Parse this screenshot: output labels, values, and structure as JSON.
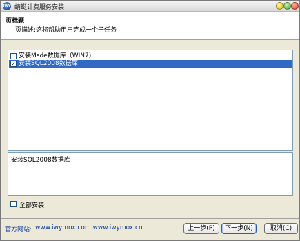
{
  "window": {
    "title": "蜻蜓计费服务安装",
    "app_icon_text": "IWY"
  },
  "header": {
    "title": "页标题",
    "description": "页描述:这将帮助用户完成一个子任务"
  },
  "components": [
    {
      "label": "安装Msde数据库（WIN7)",
      "checked": false,
      "selected": false
    },
    {
      "label": "安装SQL2008数据库",
      "checked": true,
      "selected": true
    }
  ],
  "description_box": {
    "text": "安装SQL2008数据库"
  },
  "select_all": {
    "label": "全部安装",
    "checked": false
  },
  "footer": {
    "site_label": "官方网站:",
    "site_links": "www.iwymox.com www.iwymox.cn",
    "prev_label": "上一步(P)",
    "next_label": "下一步(N)",
    "cancel_label": "取消(C)"
  }
}
